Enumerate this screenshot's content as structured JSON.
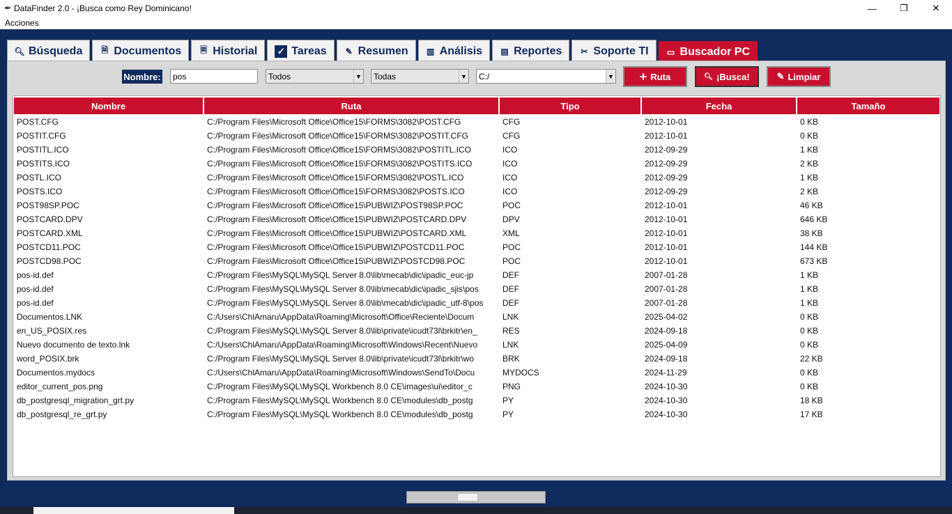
{
  "window": {
    "title": "DataFinder 2.0 - ¡Busca como Rey Dominicano!",
    "controls": {
      "minimize": "—",
      "restore": "❐",
      "close": "✕"
    }
  },
  "menu": {
    "items": [
      "Acciones"
    ]
  },
  "tabs": [
    {
      "label": "Búsqueda",
      "icon": "search-icon"
    },
    {
      "label": "Documentos",
      "icon": "document-icon"
    },
    {
      "label": "Historial",
      "icon": "history-icon"
    },
    {
      "label": "Tareas",
      "icon": "checkbox-icon"
    },
    {
      "label": "Resumen",
      "icon": "summary-icon"
    },
    {
      "label": "Análisis",
      "icon": "bar-chart-icon"
    },
    {
      "label": "Reportes",
      "icon": "report-icon"
    },
    {
      "label": "Soporte TI",
      "icon": "tools-icon"
    },
    {
      "label": "Buscador PC",
      "icon": "laptop-icon",
      "active": true
    }
  ],
  "search": {
    "name_label": "Nombre:",
    "name_value": "pos",
    "type_select": "Todos",
    "date_select": "Todas",
    "path_select": "C:/",
    "buttons": {
      "ruta": "Ruta",
      "busca": "¡Busca!",
      "limpiar": "Limpiar"
    }
  },
  "table": {
    "columns": [
      "Nombre",
      "Ruta",
      "Tipo",
      "Fecha",
      "Tamaño"
    ],
    "rows": [
      [
        "POST.CFG",
        "C:/Program Files\\Microsoft Office\\Office15\\FORMS\\3082\\POST.CFG",
        "CFG",
        "2012-10-01",
        "0 KB"
      ],
      [
        "POSTIT.CFG",
        "C:/Program Files\\Microsoft Office\\Office15\\FORMS\\3082\\POSTIT.CFG",
        "CFG",
        "2012-10-01",
        "0 KB"
      ],
      [
        "POSTITL.ICO",
        "C:/Program Files\\Microsoft Office\\Office15\\FORMS\\3082\\POSTITL.ICO",
        "ICO",
        "2012-09-29",
        "1 KB"
      ],
      [
        "POSTITS.ICO",
        "C:/Program Files\\Microsoft Office\\Office15\\FORMS\\3082\\POSTITS.ICO",
        "ICO",
        "2012-09-29",
        "2 KB"
      ],
      [
        "POSTL.ICO",
        "C:/Program Files\\Microsoft Office\\Office15\\FORMS\\3082\\POSTL.ICO",
        "ICO",
        "2012-09-29",
        "1 KB"
      ],
      [
        "POSTS.ICO",
        "C:/Program Files\\Microsoft Office\\Office15\\FORMS\\3082\\POSTS.ICO",
        "ICO",
        "2012-09-29",
        "2 KB"
      ],
      [
        "POST98SP.POC",
        "C:/Program Files\\Microsoft Office\\Office15\\PUBWIZ\\POST98SP.POC",
        "POC",
        "2012-10-01",
        "46 KB"
      ],
      [
        "POSTCARD.DPV",
        "C:/Program Files\\Microsoft Office\\Office15\\PUBWIZ\\POSTCARD.DPV",
        "DPV",
        "2012-10-01",
        "646 KB"
      ],
      [
        "POSTCARD.XML",
        "C:/Program Files\\Microsoft Office\\Office15\\PUBWIZ\\POSTCARD.XML",
        "XML",
        "2012-10-01",
        "38 KB"
      ],
      [
        "POSTCD11.POC",
        "C:/Program Files\\Microsoft Office\\Office15\\PUBWIZ\\POSTCD11.POC",
        "POC",
        "2012-10-01",
        "144 KB"
      ],
      [
        "POSTCD98.POC",
        "C:/Program Files\\Microsoft Office\\Office15\\PUBWIZ\\POSTCD98.POC",
        "POC",
        "2012-10-01",
        "673 KB"
      ],
      [
        "pos-id.def",
        "C:/Program Files\\MySQL\\MySQL Server 8.0\\lib\\mecab\\dic\\ipadic_euc-jp",
        "DEF",
        "2007-01-28",
        "1 KB"
      ],
      [
        "pos-id.def",
        "C:/Program Files\\MySQL\\MySQL Server 8.0\\lib\\mecab\\dic\\ipadic_sjis\\pos",
        "DEF",
        "2007-01-28",
        "1 KB"
      ],
      [
        "pos-id.def",
        "C:/Program Files\\MySQL\\MySQL Server 8.0\\lib\\mecab\\dic\\ipadic_utf-8\\pos",
        "DEF",
        "2007-01-28",
        "1 KB"
      ],
      [
        "Documentos.LNK",
        "C:/Users\\ChlAmaru\\AppData\\Roaming\\Microsoft\\Office\\Reciente\\Docum",
        "LNK",
        "2025-04-02",
        "0 KB"
      ],
      [
        "en_US_POSIX.res",
        "C:/Program Files\\MySQL\\MySQL Server 8.0\\lib\\private\\icudt73l\\brkitr\\en_",
        "RES",
        "2024-09-18",
        "0 KB"
      ],
      [
        "Nuevo documento de texto.lnk",
        "C:/Users\\ChlAmaru\\AppData\\Roaming\\Microsoft\\Windows\\Recent\\Nuevo",
        "LNK",
        "2025-04-09",
        "0 KB"
      ],
      [
        "word_POSIX.brk",
        "C:/Program Files\\MySQL\\MySQL Server 8.0\\lib\\private\\icudt73l\\brkitr\\wo",
        "BRK",
        "2024-09-18",
        "22 KB"
      ],
      [
        "Documentos.mydocs",
        "C:/Users\\ChlAmaru\\AppData\\Roaming\\Microsoft\\Windows\\SendTo\\Docu",
        "MYDOCS",
        "2024-11-29",
        "0 KB"
      ],
      [
        "editor_current_pos.png",
        "C:/Program Files\\MySQL\\MySQL Workbench 8.0 CE\\images\\ui\\editor_c",
        "PNG",
        "2024-10-30",
        "0 KB"
      ],
      [
        "db_postgresql_migration_grt.py",
        "C:/Program Files\\MySQL\\MySQL Workbench 8.0 CE\\modules\\db_postg",
        "PY",
        "2024-10-30",
        "18 KB"
      ],
      [
        "db_postgresql_re_grt.py",
        "C:/Program Files\\MySQL\\MySQL Workbench 8.0 CE\\modules\\db_postg",
        "PY",
        "2024-10-30",
        "17 KB"
      ]
    ]
  }
}
